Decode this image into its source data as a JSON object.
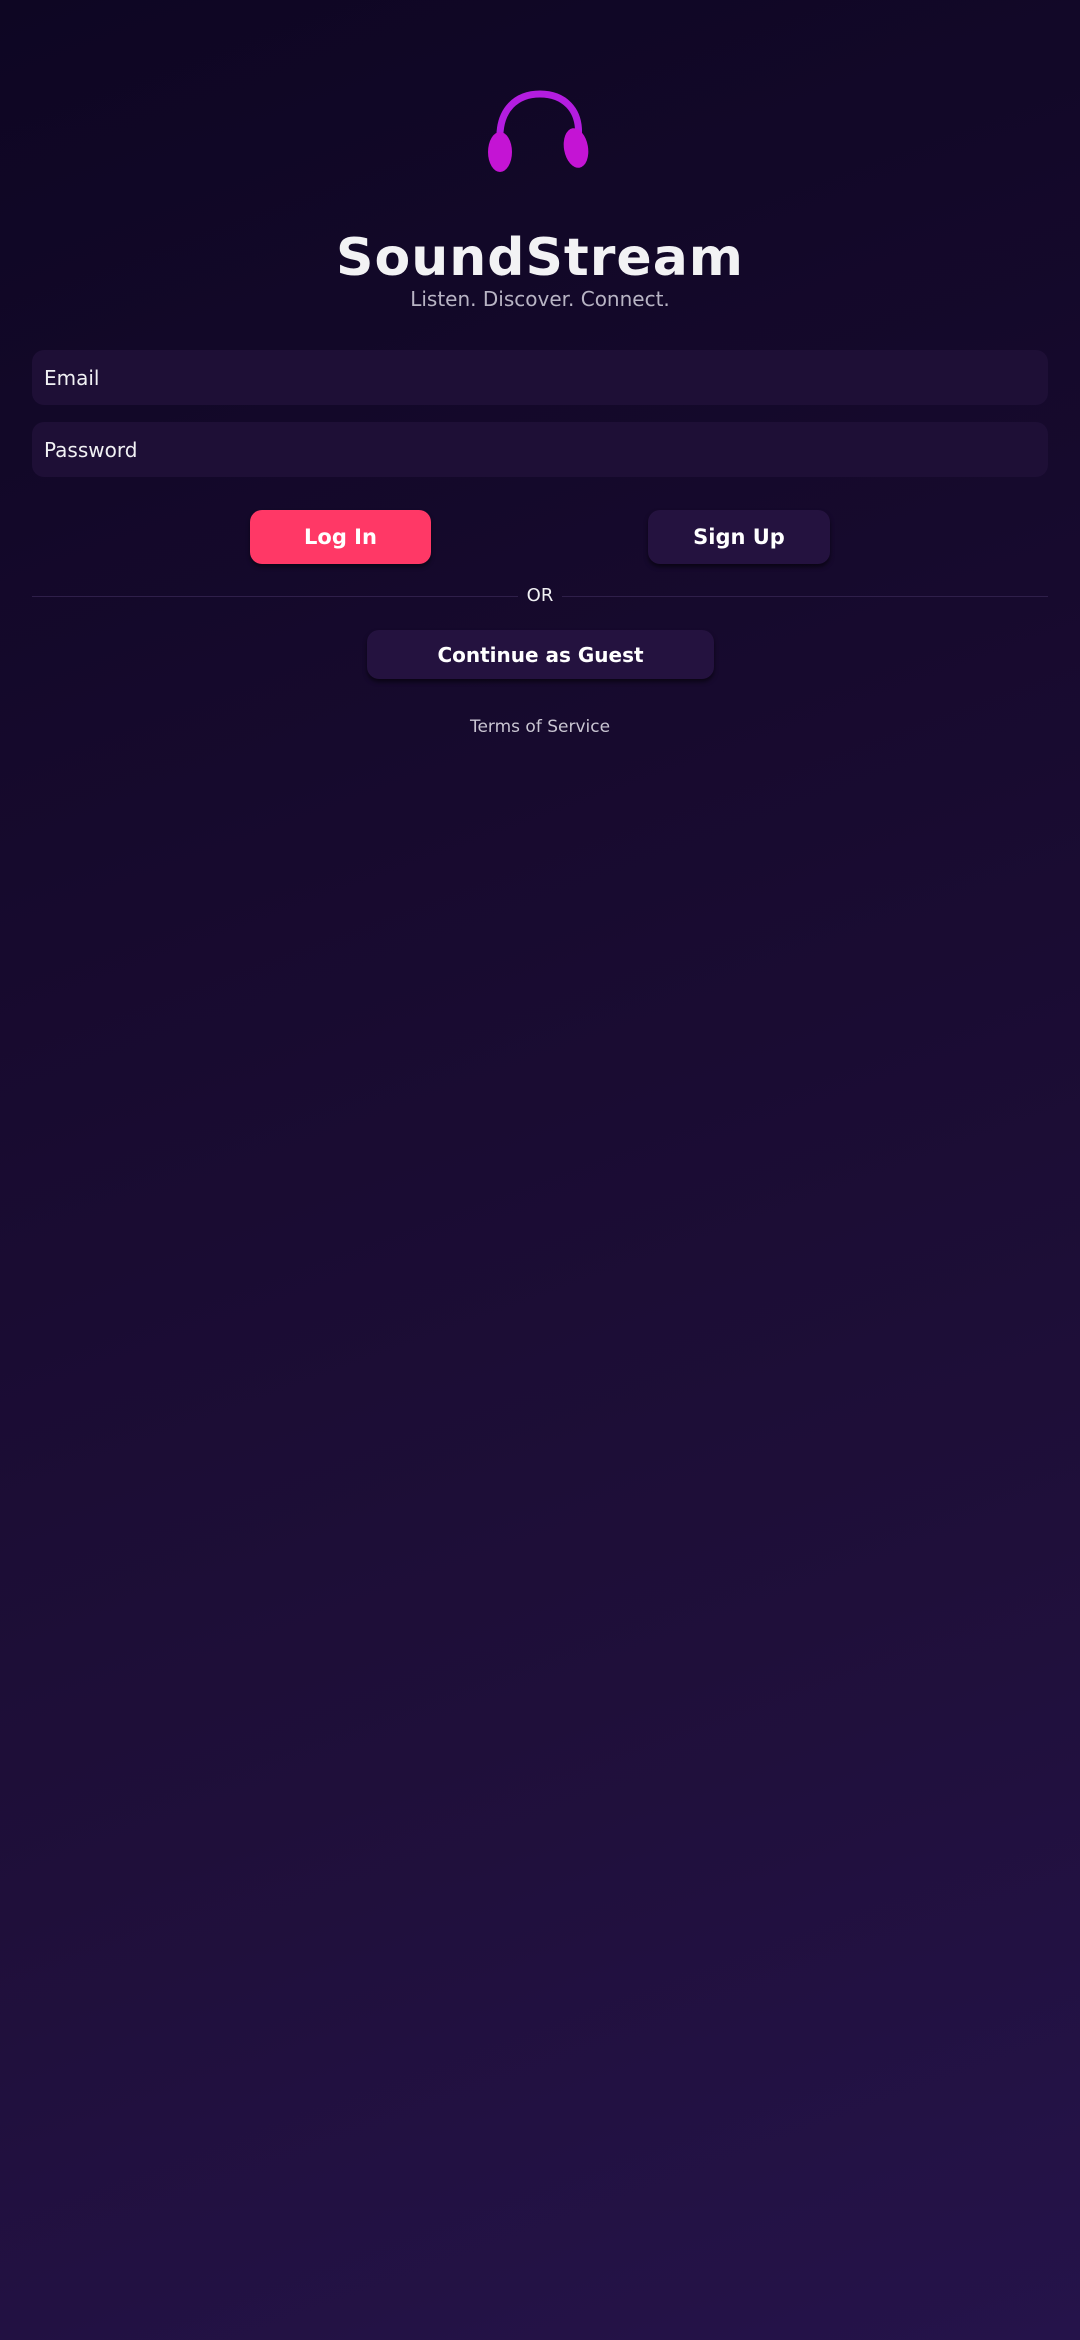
{
  "brand": {
    "logo_icon": "headphones-icon",
    "logo_color": "#c21ad9",
    "title": "SoundStream",
    "tagline": "Listen. Discover. Connect."
  },
  "form": {
    "email_placeholder": "Email",
    "password_placeholder": "Password"
  },
  "actions": {
    "login_label": "Log In",
    "signup_label": "Sign Up",
    "divider_label": "OR",
    "guest_label": "Continue as Guest"
  },
  "footer": {
    "text": "Terms of Service"
  },
  "colors": {
    "accent": "#ff3866",
    "background_top": "#0e0623",
    "background_bottom": "#25134a",
    "surface": "#1e0f36"
  }
}
